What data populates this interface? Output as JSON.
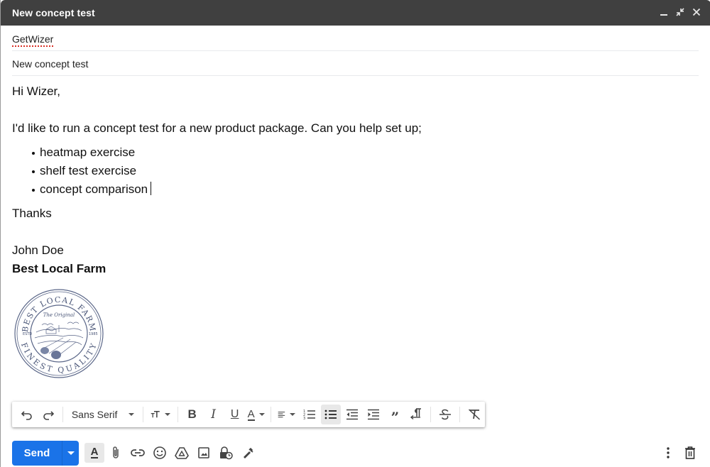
{
  "window": {
    "title": "New concept test",
    "controls": {
      "minimize_icon": "minimize-icon",
      "exit_fullscreen_icon": "exit-fullscreen-icon",
      "close_icon": "close-icon"
    }
  },
  "compose": {
    "to_value": "GetWizer",
    "subject_value": "New concept test"
  },
  "message": {
    "greeting": "Hi Wizer,",
    "intro": "I'd like to run a concept test for a new product package. Can you help set up;",
    "items": [
      "heatmap exercise",
      "shelf test exercise",
      "concept comparison"
    ],
    "closing": "Thanks",
    "signature_name": "John Doe",
    "signature_company": "Best Local Farm",
    "logo": {
      "top_text": "BEST LOCAL FARM",
      "bottom_text": "FINEST QUALITY",
      "center_text": "The Original",
      "left_text": "ESTD",
      "right_text": "1985"
    }
  },
  "format_toolbar": {
    "font_family": "Sans Serif",
    "buttons": [
      "undo",
      "redo",
      "font-family",
      "font-size",
      "bold",
      "italic",
      "underline",
      "text-color",
      "align",
      "numbered-list",
      "bulleted-list",
      "indent-less",
      "indent-more",
      "quote",
      "right-to-left",
      "strikethrough",
      "remove-formatting"
    ],
    "active": "bulleted-list"
  },
  "bottom_bar": {
    "send_label": "Send",
    "tools": [
      "formatting-options",
      "attach-files",
      "insert-link",
      "insert-emoji",
      "insert-drive-file",
      "insert-photo",
      "confidential-mode",
      "insert-signature"
    ],
    "right_tools": [
      "more-options",
      "discard-draft"
    ]
  }
}
